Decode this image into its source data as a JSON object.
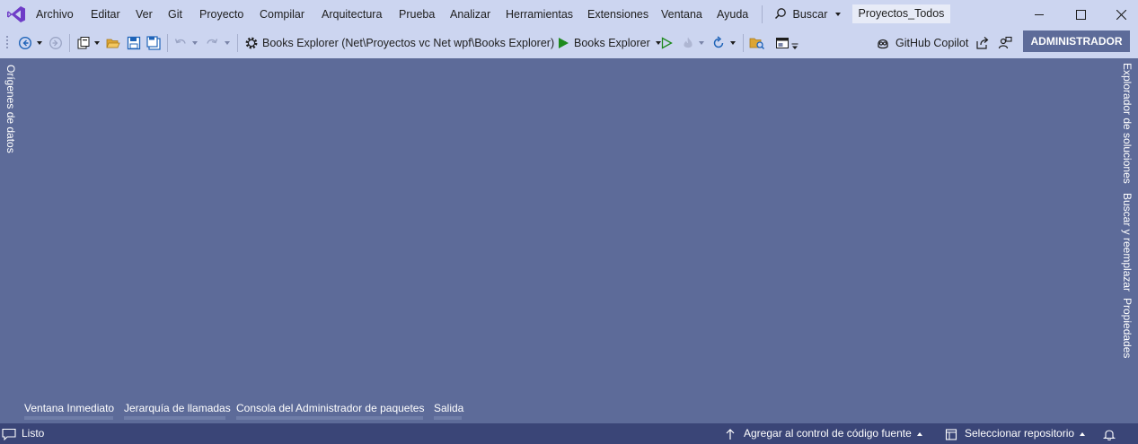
{
  "title_bar": {
    "menu": [
      {
        "id": "archivo",
        "label": "Archivo"
      },
      {
        "id": "editar",
        "label": "Editar"
      },
      {
        "id": "ver",
        "label": "Ver"
      },
      {
        "id": "git",
        "label": "Git"
      },
      {
        "id": "proyecto",
        "label": "Proyecto"
      },
      {
        "id": "compilar",
        "label": "Compilar"
      },
      {
        "id": "arquitectura",
        "label": "Arquitectura"
      },
      {
        "id": "prueba",
        "label": "Prueba"
      },
      {
        "id": "analizar",
        "label": "Analizar"
      },
      {
        "id": "herramientas",
        "label": "Herramientas"
      },
      {
        "id": "extensiones",
        "label": "Extensiones"
      },
      {
        "id": "ventana",
        "label": "Ventana"
      },
      {
        "id": "ayuda",
        "label": "Ayuda"
      }
    ],
    "search_label": "Buscar",
    "solution_name": "Proyectos_Todos"
  },
  "toolbar": {
    "startup_project_path": "Books Explorer (Net\\Proyectos vc Net wpf\\Books Explorer)",
    "run_target": "Books Explorer",
    "copilot_label": "GitHub Copilot",
    "admin_label": "ADMINISTRADOR"
  },
  "side_tabs": {
    "left": [
      "Orígenes de datos"
    ],
    "right": [
      "Explorador de soluciones",
      "Buscar y reemplazar",
      "Propiedades"
    ]
  },
  "bottom_tabs": [
    "Ventana Inmediato",
    "Jerarquía de llamadas",
    "Consola del Administrador de paquetes",
    "Salida"
  ],
  "status_bar": {
    "status": "Listo",
    "source_control": "Agregar al control de código fuente",
    "repository": "Seleccionar repositorio"
  },
  "colors": {
    "chrome": "#CCD5F0",
    "workspace": "#5D6B99",
    "status_bar": "#3A4577",
    "run_green": "#1E8A1E",
    "vs_purple": "#6E3CC7"
  }
}
